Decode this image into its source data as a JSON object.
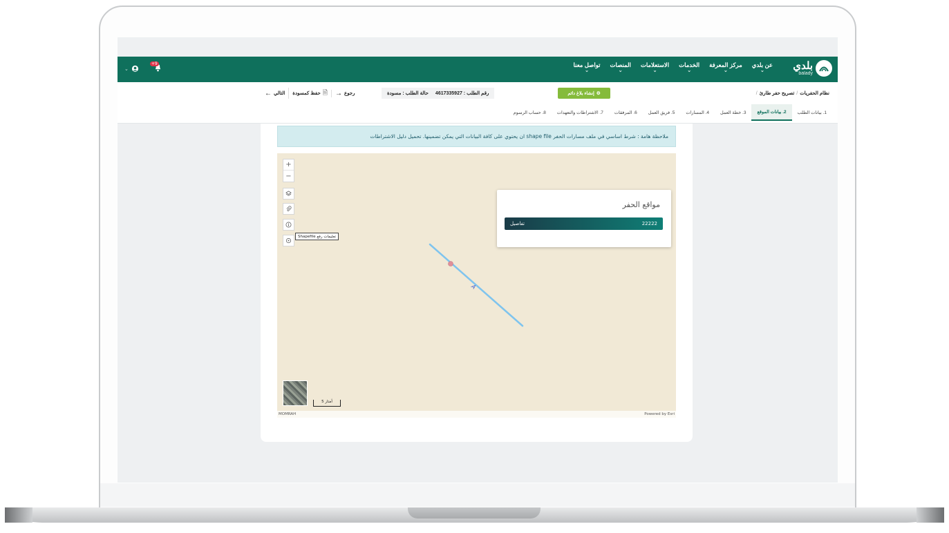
{
  "nav": {
    "brand_ar": "بلدي",
    "brand_en": "balady",
    "menu": [
      "عن بلدي",
      "مركز المعرفة",
      "الخدمات",
      "الاستعلامات",
      "المنصات",
      "تواصل معنا"
    ],
    "notification_count": "+9"
  },
  "breadcrumb": {
    "root": "نظام الحفريات",
    "current": "تصريح حفر طارئ",
    "separator": "/"
  },
  "report_button": "إنشاء بلاغ دائم",
  "request": {
    "number_label": "رقم الطلب : 4617335927",
    "status_label": "حالة الطلب : مسودة"
  },
  "actions": {
    "back": "رجوع",
    "save_draft": "حفظ كمسودة",
    "next": "التالي"
  },
  "steps": [
    "1. بيانات الطلب",
    "2. بيانات الموقع",
    "3. خطة العمل",
    "4. المسارات",
    "5. فريق العمل",
    "6. المرفقات",
    "7. الاشتراطات والتعهدات",
    "8. حساب الرسوم"
  ],
  "active_step": "2. بيانات الموقع",
  "notice": "ملاحظة هامة : شرط اساسي في ملف مسارات الحفر shape file ان يحتوي على كافة البيانات التي يمكن تضمينها. تحميل دليل الاشتراطات",
  "map": {
    "zoom_in": "+",
    "zoom_out": "−",
    "tooltip": "تعليمات رفع Shapefile",
    "popup_title": "مواقع الحفر",
    "popup_row_value": "22222",
    "popup_row_action": "تفاصيل",
    "scale_label": "5 أمتار",
    "attribution_left": "MOMRAH",
    "attribution_right": "Powered by Esri",
    "line_color": "#7fc4ee",
    "point_color": "#e0909a"
  },
  "colors": {
    "primary": "#0f705c",
    "accent_green": "#85bb3b",
    "notice_bg": "#d3ecef",
    "map_bg": "#f1e9d6"
  }
}
